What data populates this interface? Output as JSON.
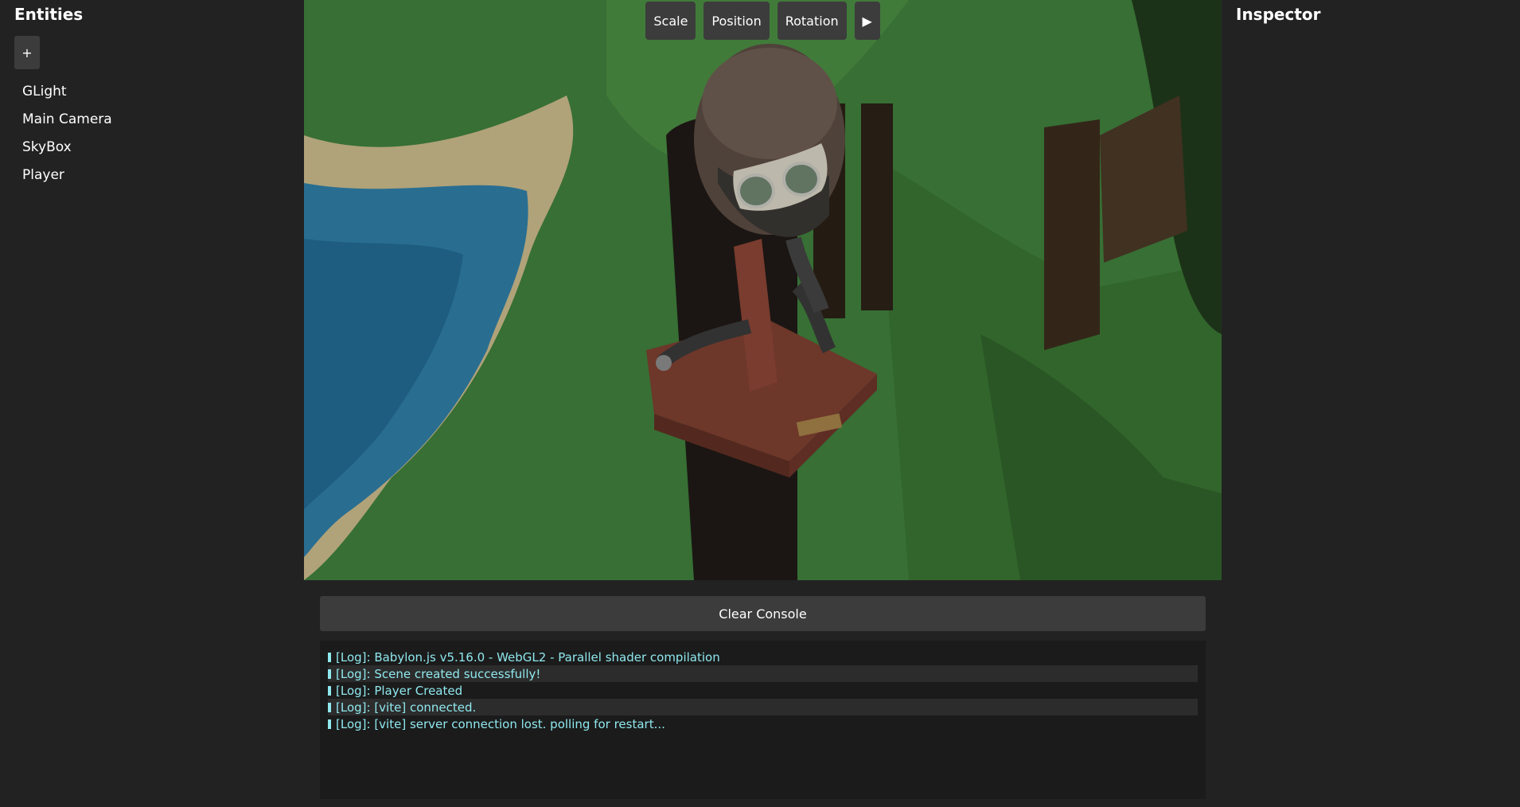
{
  "left_panel": {
    "title": "Entities",
    "add_label": "+",
    "entities": [
      "GLight",
      "Main Camera",
      "SkyBox",
      "Player"
    ]
  },
  "right_panel": {
    "title": "Inspector"
  },
  "toolbar": {
    "scale_label": "Scale",
    "position_label": "Position",
    "rotation_label": "Rotation",
    "play_label": "▶"
  },
  "console": {
    "clear_label": "Clear Console",
    "logs": [
      "[Log]: Babylon.js v5.16.0 - WebGL2 - Parallel shader compilation",
      "[Log]: Scene created successfully!",
      "[Log]: Player Created",
      "[Log]: [vite] connected.",
      "[Log]: [vite] server connection lost. polling for restart..."
    ]
  },
  "colors": {
    "background": "#222222",
    "button": "#3c3c3c",
    "console_bg": "#1b1b1b",
    "log_text": "#8fe8ee"
  }
}
